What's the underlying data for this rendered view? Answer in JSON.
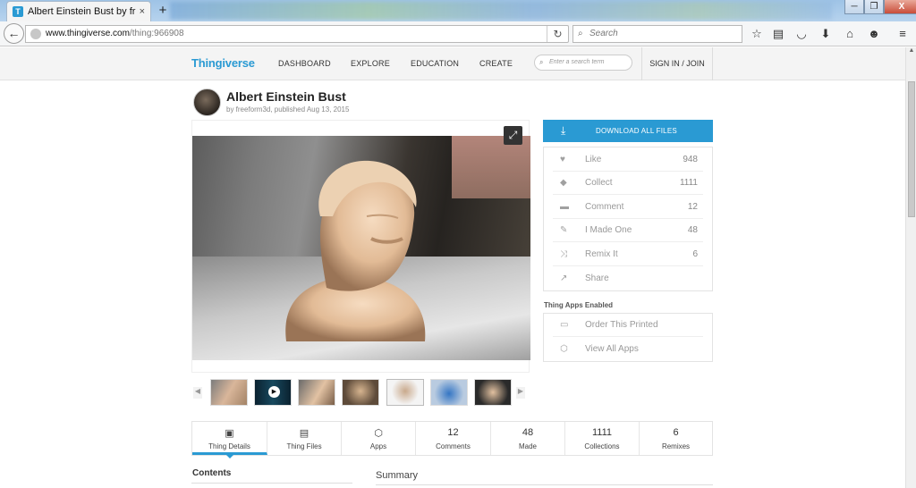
{
  "browser": {
    "tab_title": "Albert Einstein Bust by free...",
    "tab_close": "×",
    "new_tab": "+",
    "url_host": "www.thingiverse.com",
    "url_path": "/thing:966908",
    "search_placeholder": "Search",
    "window_buttons": [
      "─",
      "❐",
      "X"
    ]
  },
  "site": {
    "logo": "Thingiverse",
    "nav": [
      "DASHBOARD",
      "EXPLORE",
      "EDUCATION",
      "CREATE"
    ],
    "search_placeholder": "Enter a search term",
    "signin": "SIGN IN / JOIN"
  },
  "thing": {
    "title": "Albert Einstein Bust",
    "byline": "by freeform3d, published Aug 13, 2015"
  },
  "panel": {
    "download_label": "DOWNLOAD ALL FILES",
    "actions": [
      {
        "icon": "heart-icon",
        "glyph": "♥",
        "label": "Like",
        "count": "948"
      },
      {
        "icon": "collect-icon",
        "glyph": "◆",
        "label": "Collect",
        "count": "1111"
      },
      {
        "icon": "comment-icon",
        "glyph": "▬",
        "label": "Comment",
        "count": "12"
      },
      {
        "icon": "made-icon",
        "glyph": "✎",
        "label": "I Made One",
        "count": "48"
      },
      {
        "icon": "remix-icon",
        "glyph": "⤨",
        "label": "Remix It",
        "count": "6"
      },
      {
        "icon": "share-icon",
        "glyph": "↗",
        "label": "Share",
        "count": ""
      }
    ],
    "apps_heading": "Thing Apps Enabled",
    "apps": [
      {
        "icon": "printer-icon",
        "glyph": "▭",
        "label": "Order This Printed"
      },
      {
        "icon": "cube-icon",
        "glyph": "⬡",
        "label": "View All Apps"
      }
    ]
  },
  "bottom_tabs": [
    {
      "name": "tab-thing-details",
      "icon": "▣",
      "count": "",
      "label": "Thing Details"
    },
    {
      "name": "tab-thing-files",
      "icon": "▤",
      "count": "",
      "label": "Thing Files"
    },
    {
      "name": "tab-apps",
      "icon": "⬡",
      "count": "",
      "label": "Apps"
    },
    {
      "name": "tab-comments",
      "icon": "",
      "count": "12",
      "label": "Comments"
    },
    {
      "name": "tab-made",
      "icon": "",
      "count": "48",
      "label": "Made"
    },
    {
      "name": "tab-collections",
      "icon": "",
      "count": "1111",
      "label": "Collections"
    },
    {
      "name": "tab-remixes",
      "icon": "",
      "count": "6",
      "label": "Remixes"
    }
  ],
  "sections": {
    "contents": "Contents",
    "summary": "Summary"
  },
  "colors": {
    "accent": "#2a9ad3"
  }
}
